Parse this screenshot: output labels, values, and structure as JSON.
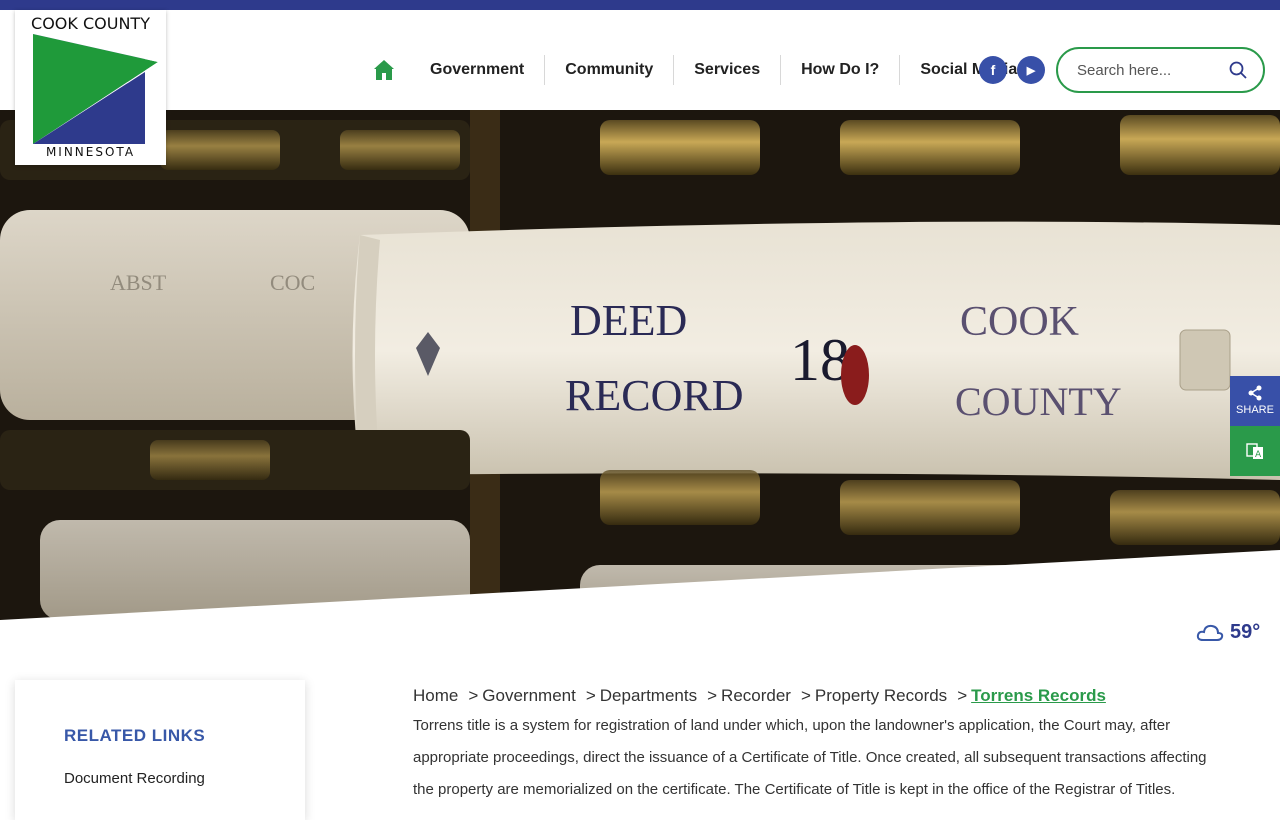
{
  "logo": {
    "top_text": "COOK COUNTY",
    "bottom_text": "MINNESOTA"
  },
  "nav": {
    "home_icon": "home-icon",
    "items": [
      "Government",
      "Community",
      "Services",
      "How Do I?",
      "Social Media"
    ]
  },
  "social": {
    "facebook": "f",
    "youtube": "▶"
  },
  "search": {
    "placeholder": "Search here..."
  },
  "hero": {
    "book_lines": [
      "DEED",
      "RECORD",
      "18",
      "COOK",
      "COUNTY"
    ]
  },
  "share": {
    "label": "SHARE"
  },
  "weather": {
    "temp": "59°",
    "icon": "cloud-icon"
  },
  "sidebar": {
    "title": "RELATED LINKS",
    "links": [
      "Document Recording"
    ]
  },
  "breadcrumb": {
    "items": [
      "Home",
      "Government",
      "Departments",
      "Recorder",
      "Property Records"
    ],
    "separator": ">",
    "current": "Torrens Records"
  },
  "content": {
    "paragraph": "Torrens title is a system for registration of land under which, upon the landowner's application, the Court may, after appropriate proceedings, direct the issuance of a Certificate of Title. Once created, all subsequent transactions affecting the property are memorialized on the certificate. The Certificate of Title is kept in the office of the Registrar of Titles."
  },
  "colors": {
    "brand_blue": "#2e3a8c",
    "brand_green": "#2a9a4a",
    "link_blue": "#3858a8"
  }
}
